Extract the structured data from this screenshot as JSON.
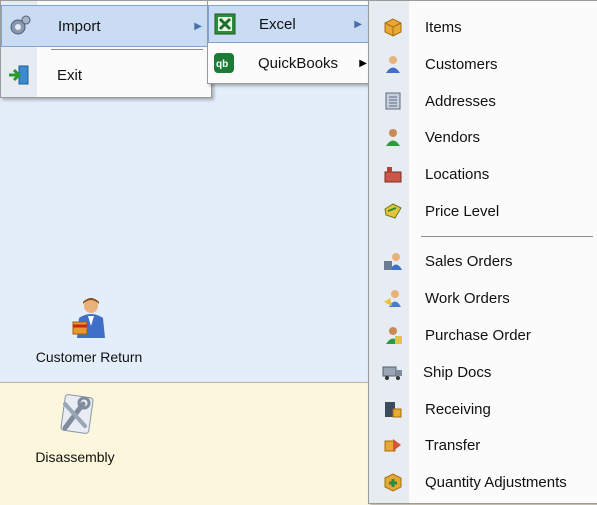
{
  "menu1": {
    "items": [
      {
        "label": "Import",
        "icon": "gear-icon"
      },
      {
        "label": "Exit",
        "icon": "exit-door-icon"
      }
    ]
  },
  "menu2": {
    "items": [
      {
        "label": "Excel",
        "icon": "excel-icon"
      },
      {
        "label": "QuickBooks",
        "icon": "quickbooks-icon"
      }
    ]
  },
  "menu3": {
    "items": [
      {
        "label": "Items",
        "icon": "box-icon"
      },
      {
        "label": "Customers",
        "icon": "person-icon"
      },
      {
        "label": "Addresses",
        "icon": "address-book-icon"
      },
      {
        "label": "Vendors",
        "icon": "vendor-person-icon"
      },
      {
        "label": "Locations",
        "icon": "building-icon"
      },
      {
        "label": "Price Level",
        "icon": "price-tag-icon"
      },
      {
        "label": "Sales Orders",
        "icon": "sales-order-icon"
      },
      {
        "label": "Work Orders",
        "icon": "work-order-icon"
      },
      {
        "label": "Purchase Order",
        "icon": "purchase-order-icon"
      },
      {
        "label": "Ship Docs",
        "icon": "truck-icon"
      },
      {
        "label": "Receiving",
        "icon": "receiving-icon"
      },
      {
        "label": "Transfer",
        "icon": "transfer-icon"
      },
      {
        "label": "Quantity Adjustments",
        "icon": "adjustment-icon"
      }
    ]
  },
  "desktop": {
    "customer_return": "Customer Return",
    "disassembly": "Disassembly"
  },
  "colors": {
    "highlight": "#c9dcf4",
    "highlight_border": "#7fa5d6",
    "top_bg": "#e4eefa",
    "bottom_bg": "#fbf6dc"
  }
}
